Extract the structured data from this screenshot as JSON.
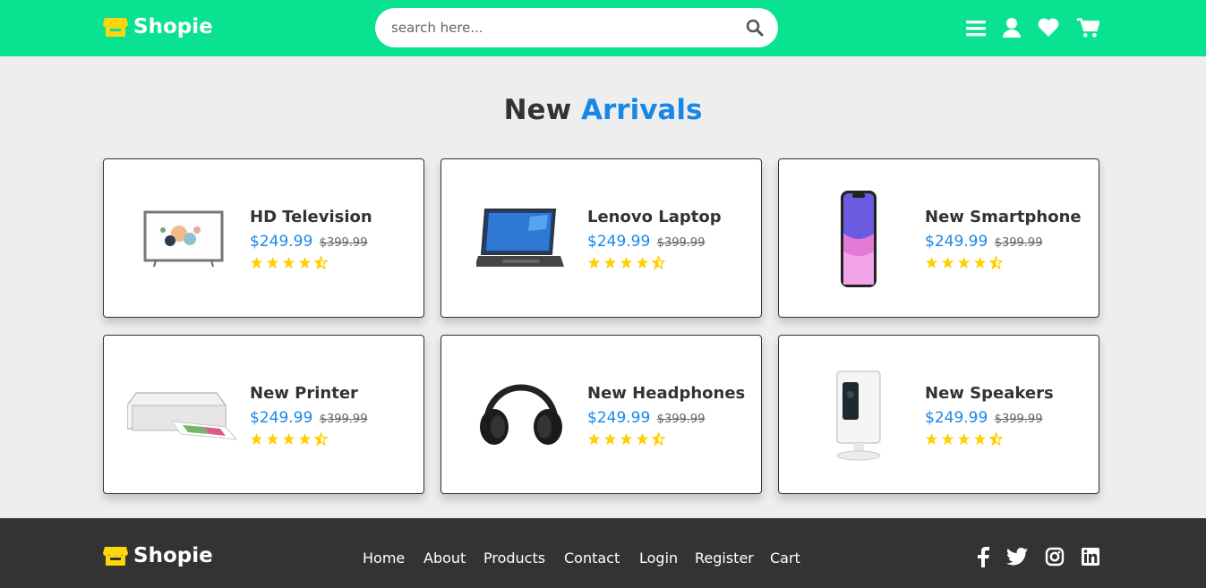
{
  "brand": {
    "name": "Shopie",
    "accent": "#08e291",
    "logo_color": "#ffd60a"
  },
  "search": {
    "placeholder": "search here..."
  },
  "header_icons": [
    "menu-icon",
    "user-icon",
    "heart-icon",
    "cart-icon"
  ],
  "section": {
    "title_part1": "New",
    "title_part2": "Arrivals",
    "accent": "#1a87e6"
  },
  "products": [
    {
      "name": "HD Television",
      "price": "$249.99",
      "old_price": "$399.99",
      "rating": 4.5,
      "image": "television"
    },
    {
      "name": "Lenovo Laptop",
      "price": "$249.99",
      "old_price": "$399.99",
      "rating": 4.5,
      "image": "laptop"
    },
    {
      "name": "New Smartphone",
      "price": "$249.99",
      "old_price": "$399.99",
      "rating": 4.5,
      "image": "smartphone"
    },
    {
      "name": "New Printer",
      "price": "$249.99",
      "old_price": "$399.99",
      "rating": 4.5,
      "image": "printer"
    },
    {
      "name": "New Headphones",
      "price": "$249.99",
      "old_price": "$399.99",
      "rating": 4.5,
      "image": "headphones"
    },
    {
      "name": "New Speakers",
      "price": "$249.99",
      "old_price": "$399.99",
      "rating": 4.5,
      "image": "speakers"
    }
  ],
  "footer": {
    "links": [
      "Home",
      "About",
      "Products",
      "Contact",
      "Login",
      "Register",
      "Cart"
    ],
    "social": [
      "facebook-icon",
      "twitter-icon",
      "instagram-icon",
      "linkedin-icon"
    ]
  }
}
